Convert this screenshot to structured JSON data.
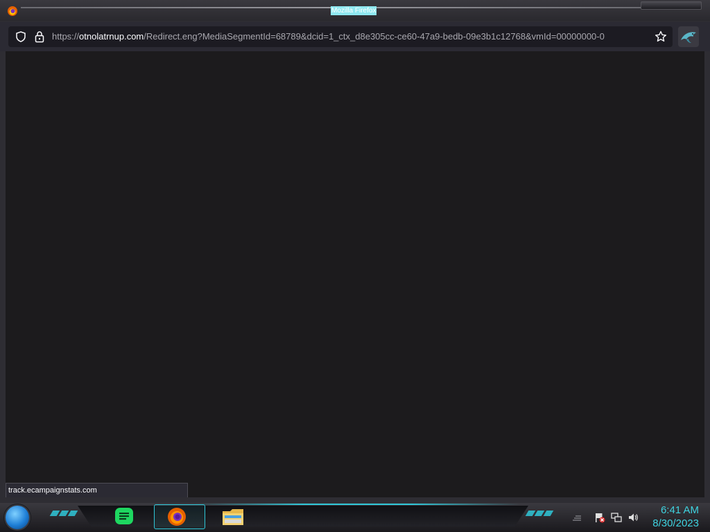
{
  "window": {
    "title": "Mozilla Firefox"
  },
  "navbar": {
    "url_prefix": "https://",
    "url_host": "otnolatrnup.com",
    "url_rest": "/Redirect.eng?MediaSegmentId=68789&dcid=1_ctx_d8e305cc-ce60-47a9-bedb-09e3b1c12768&vmId=00000000-0"
  },
  "status": {
    "link_preview": "track.ecampaignstats.com"
  },
  "taskbar": {
    "apps": [
      "start-orb",
      "chat-app",
      "firefox",
      "file-explorer"
    ],
    "clock": {
      "time": "6:41 AM",
      "date": "8/30/2023"
    }
  },
  "colors": {
    "accent": "#2fc7d8",
    "content_bg": "#1c1b1d",
    "urlbar_bg": "#1c1b22"
  }
}
